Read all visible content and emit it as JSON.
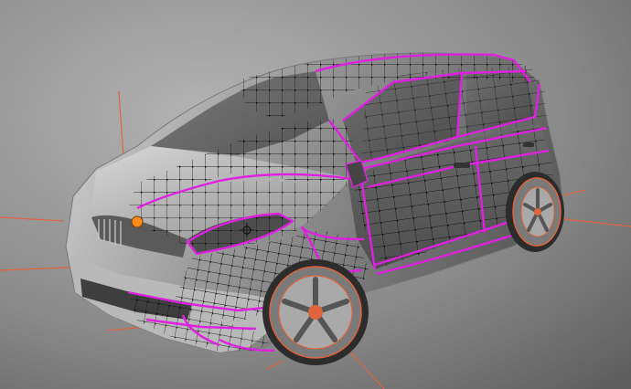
{
  "viewport": {
    "mode": "edit-mode-wireframe-overlay",
    "object": "hatchback-car",
    "colors": {
      "background_light": "#a9a9a9",
      "background_dark": "#5e5e5e",
      "body_light": "#cfcfcf",
      "body_dark": "#5a5a5a",
      "selected_edge": "#e020e0",
      "wire": "#111111",
      "vertex": "#000000",
      "active_vertex": "#ff8a1a",
      "guide": "#e0643c"
    }
  }
}
